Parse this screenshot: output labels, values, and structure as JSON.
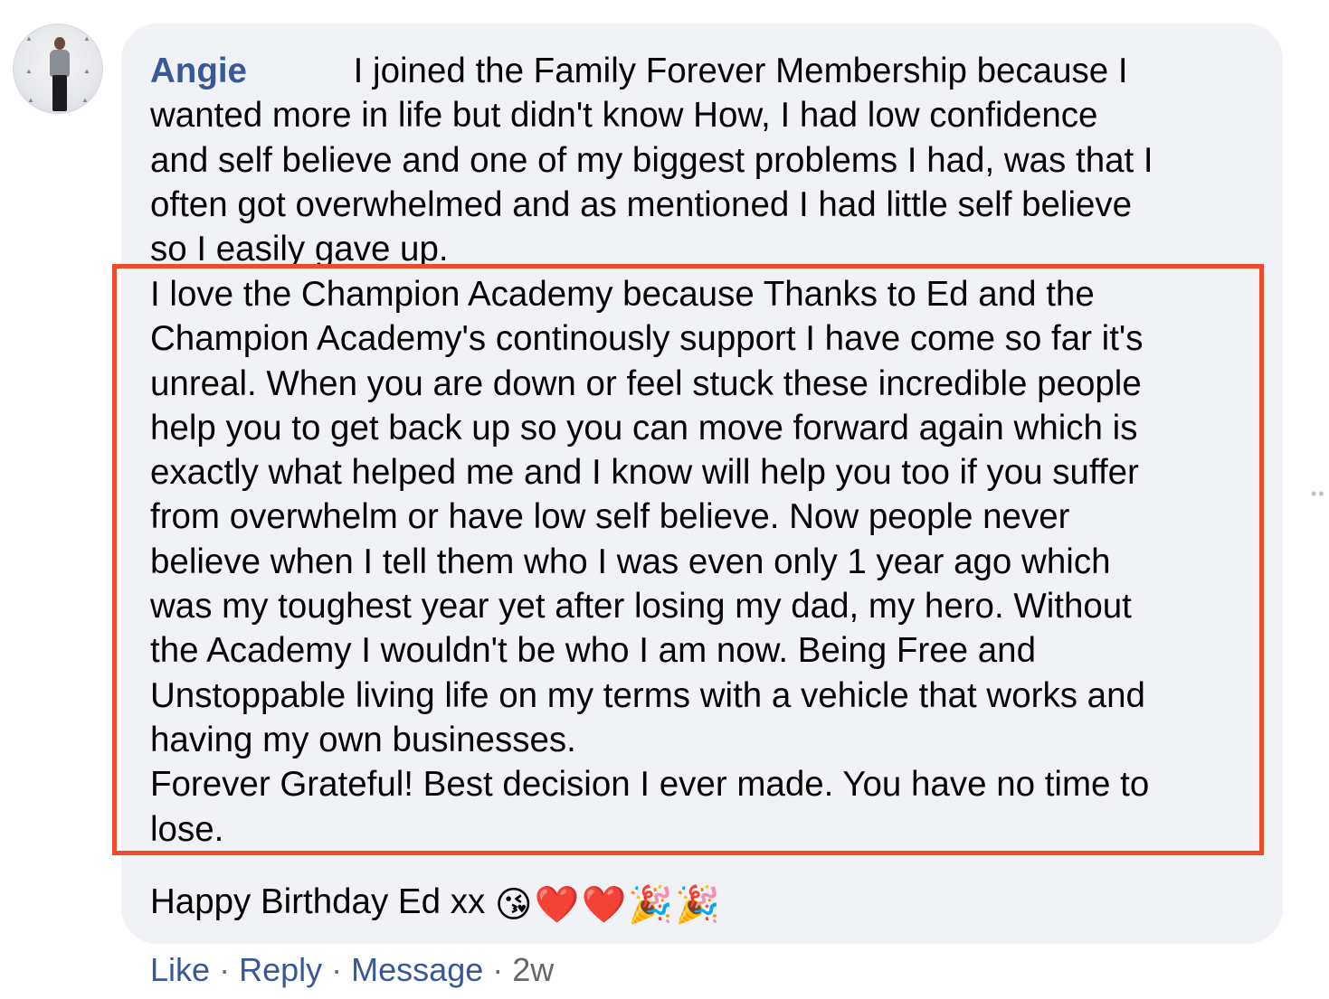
{
  "comment": {
    "author": "Angie",
    "paragraph1_lines": [
      "I joined the Family Forever Membership because I",
      "wanted more in life but didn't know How, I had low confidence",
      "and self believe and one of my biggest problems I had, was that I",
      "often got overwhelmed and as mentioned I had little self believe",
      "so I easily gave up."
    ],
    "paragraph2_lines": [
      "I love the Champion Academy because Thanks to Ed and the",
      "Champion Academy's continously support I have come so far it's",
      "unreal. When you are down or feel stuck these incredible people",
      "help you to get back up so you can move forward again which is",
      "exactly what helped me and I know will help you too if you suffer",
      "from overwhelm or have low self believe. Now people never",
      "believe when I tell them who I was even only 1 year ago which",
      "was my toughest year yet after losing my dad, my hero. Without",
      "the Academy I wouldn't be who I am now. Being Free and",
      "Unstoppable living life on my terms with a vehicle that works and",
      "having my own businesses.",
      "Forever Grateful! Best decision I ever made. You have no time to",
      "lose."
    ],
    "closing_text": "Happy Birthday Ed xx",
    "closing_emojis": [
      "😘",
      "❤️",
      "❤️",
      "🎉",
      "🎉"
    ]
  },
  "actions": {
    "like": "Like",
    "reply": "Reply",
    "message": "Message",
    "separator": "·",
    "time": "2w"
  },
  "colors": {
    "bubble_background": "#f0f2f5",
    "author_link": "#385898",
    "highlight_border": "#ee4b2b",
    "meta_text": "#65676b"
  },
  "icons": {
    "avatar": "profile-photo",
    "more_options": "more-options-icon"
  }
}
